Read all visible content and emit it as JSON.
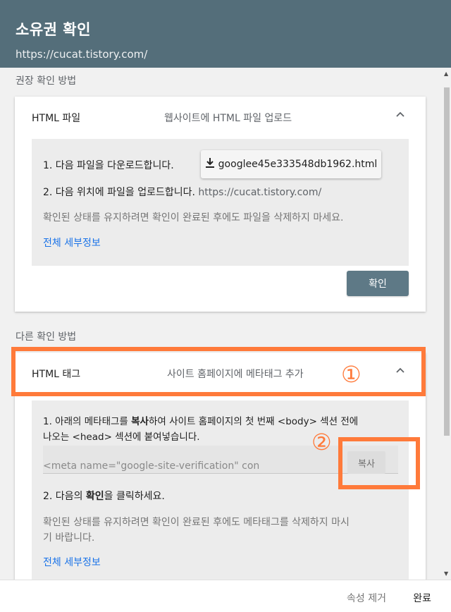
{
  "header": {
    "title": "소유권 확인",
    "url": "https://cucat.tistory.com/"
  },
  "recommended": {
    "label": "권장 확인 방법",
    "card": {
      "name": "HTML 파일",
      "desc": "웹사이트에 HTML 파일 업로드",
      "chevron": "^",
      "step1": "1. 다음 파일을 다운로드합니다.",
      "download_label": "googlee45e333548db1962.html",
      "step2": "2. 다음 위치에 파일을 업로드합니다.",
      "step2_url": "https://cucat.tistory.com/",
      "note": "확인된 상태를 유지하려면 확인이 완료된 후에도 파일을 삭제하지 마세요.",
      "details_link": "전체 세부정보",
      "confirm_label": "확인"
    }
  },
  "other": {
    "label": "다른 확인 방법",
    "card": {
      "name": "HTML 태그",
      "desc": "사이트 홈페이지에 메타태그 추가",
      "chevron": "^",
      "step1_a": "1. 아래의 메타태그를 ",
      "step1_b": "복사",
      "step1_c": "하여 사이트 홈페이지의 첫 번째 <body> 섹션 전에",
      "step1_line2": "나오는 <head> 섹션에 붙여넣습니다.",
      "meta_value": "<meta name=\"google-site-verification\" con",
      "copy_label": "복사",
      "step2_a": "2. 다음의 ",
      "step2_b": "확인",
      "step2_c": "을 클릭하세요.",
      "note_line1": "확인된 상태를 유지하려면 확인이 완료된 후에도 메타태그를 삭제하지 마시",
      "note_line2": "기 바랍니다.",
      "details_link": "전체 세부정보"
    }
  },
  "annotations": {
    "marker1": "①",
    "marker2": "②",
    "highlight_color": "#ff7a3a"
  },
  "footer": {
    "remove_label": "속성 제거",
    "done_label": "완료"
  },
  "colors": {
    "header_bg": "#546e7a",
    "confirm_bg": "#5e7986",
    "link": "#1a73e8"
  }
}
